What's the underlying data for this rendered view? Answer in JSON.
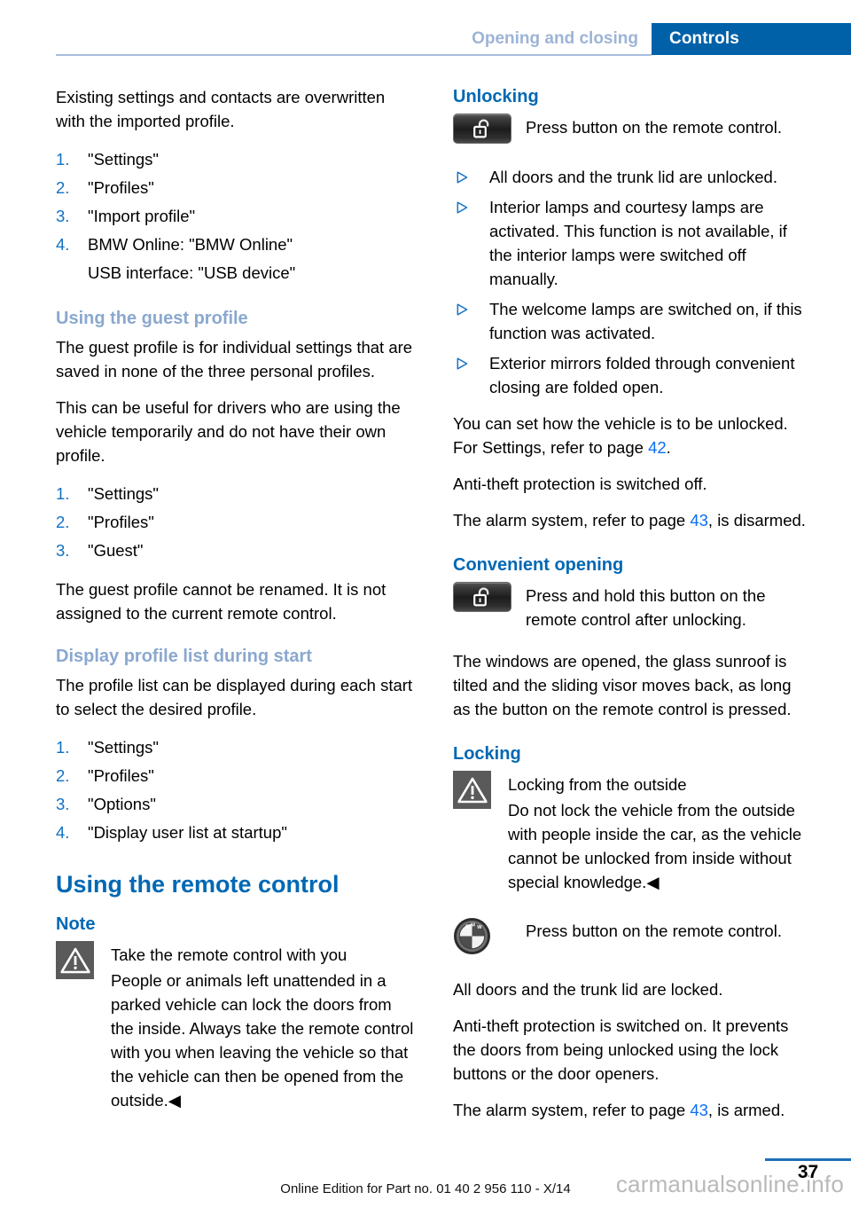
{
  "header": {
    "section_label": "Opening and closing",
    "chapter_label": "Controls"
  },
  "left_column": {
    "intro_paragraph": "Existing settings and contacts are overwritten with the imported profile.",
    "import_steps": [
      {
        "num": "1.",
        "text": "\"Settings\""
      },
      {
        "num": "2.",
        "text": "\"Profiles\""
      },
      {
        "num": "3.",
        "text": "\"Import profile\""
      },
      {
        "num": "4.",
        "text": "BMW Online: \"BMW Online\"",
        "sub": "USB interface: \"USB device\""
      }
    ],
    "guest_profile": {
      "heading": "Using the guest profile",
      "paragraph_1": "The guest profile is for individual settings that are saved in none of the three personal profiles.",
      "paragraph_2": "This can be useful for drivers who are using the vehicle temporarily and do not have their own profile.",
      "steps": [
        {
          "num": "1.",
          "text": "\"Settings\""
        },
        {
          "num": "2.",
          "text": "\"Profiles\""
        },
        {
          "num": "3.",
          "text": "\"Guest\""
        }
      ],
      "paragraph_3": "The guest profile cannot be renamed. It is not assigned to the current remote control."
    },
    "display_profile_list": {
      "heading": "Display profile list during start",
      "paragraph_1": "The profile list can be displayed during each start to select the desired profile.",
      "steps": [
        {
          "num": "1.",
          "text": "\"Settings\""
        },
        {
          "num": "2.",
          "text": "\"Profiles\""
        },
        {
          "num": "3.",
          "text": "\"Options\""
        },
        {
          "num": "4.",
          "text": "\"Display user list at startup\""
        }
      ]
    },
    "remote_control": {
      "heading": "Using the remote control",
      "note_heading": "Note",
      "warning_title": "Take the remote control with you",
      "warning_body": "People or animals left unattended in a parked vehicle can lock the doors from the inside. Always take the remote control with you when leaving the vehicle so that the vehicle can then be opened from the outside.◀"
    }
  },
  "right_column": {
    "unlocking": {
      "heading": "Unlocking",
      "button_caption": "Press button on the remote control.",
      "bullets": [
        "All doors and the trunk lid are unlocked.",
        "Interior lamps and courtesy lamps are activated. This function is not available, if the interior lamps were switched off manually.",
        "The welcome lamps are switched on, if this function was activated.",
        "Exterior mirrors folded through convenient closing are folded open."
      ],
      "paragraph_1_a": "You can set how the vehicle is to be unlocked. For Settings, refer to page ",
      "paragraph_1_ref": "42",
      "paragraph_1_b": ".",
      "paragraph_2": "Anti-theft protection is switched off.",
      "paragraph_3_a": "The alarm system, refer to page ",
      "paragraph_3_ref": "43",
      "paragraph_3_b": ", is disarmed."
    },
    "convenient_opening": {
      "heading": "Convenient opening",
      "button_caption": "Press and hold this button on the remote control after unlocking.",
      "paragraph": "The windows are opened, the glass sunroof is tilted and the sliding visor moves back, as long as the button on the remote control is pressed."
    },
    "locking": {
      "heading": "Locking",
      "warning_title": "Locking from the outside",
      "warning_body": "Do not lock the vehicle from the outside with people inside the car, as the vehicle cannot be unlocked from inside without special knowledge.◀",
      "bmw_caption": "Press button on the remote control.",
      "paragraph_1": "All doors and the trunk lid are locked.",
      "paragraph_2": "Anti-theft protection is switched on. It prevents the doors from being unlocked using the lock buttons or the door openers.",
      "paragraph_3_a": "The alarm system, refer to page ",
      "paragraph_3_ref": "43",
      "paragraph_3_b": ", is armed."
    }
  },
  "footer": {
    "edition_text": "Online Edition for Part no. 01 40 2 956 110 - X/14",
    "page_number": "37",
    "watermark": "carmanualsonline.info"
  },
  "colors": {
    "brand_blue": "#0061a8",
    "heading_blue": "#0068b3",
    "muted_blue": "#8aa8cf",
    "link_blue": "#0a6ff0",
    "rule_blue": "#a8bddc"
  }
}
